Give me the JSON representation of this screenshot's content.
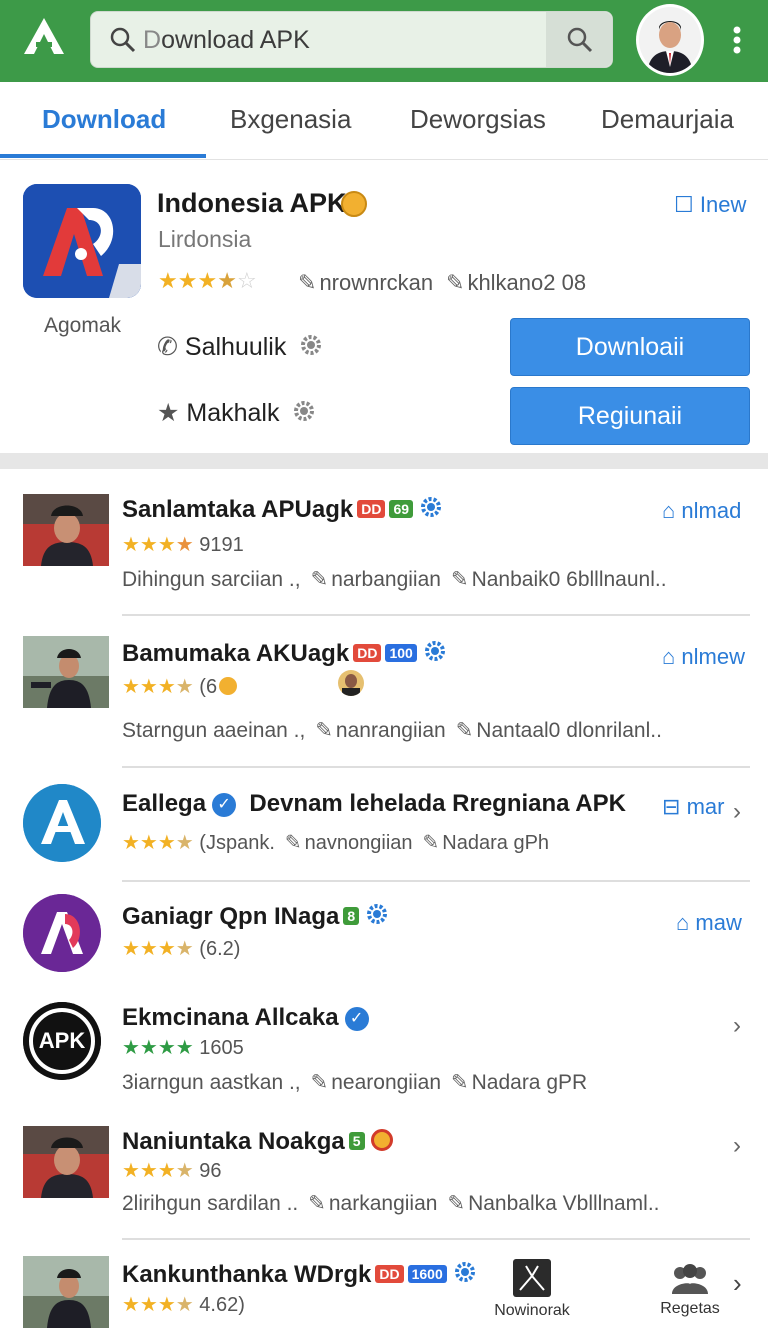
{
  "search": {
    "value": "ownload APK",
    "prefix": "D"
  },
  "tabs": [
    "Download",
    "Bxgenasia",
    "Deworgsias",
    "Demaurjaia"
  ],
  "featured": {
    "title": "Indonesia APK",
    "subtitle": "Lirdonsia",
    "developer": "Agomak",
    "new_label": "Inew",
    "rating": "3.5",
    "meta1": "nrownrckan",
    "meta2": "khlkano2 08",
    "action1": "Salhuulik",
    "action2": "Makhalk",
    "button1": "Downloaii",
    "button2": "Regiunaii"
  },
  "items": [
    {
      "name": "Sanlamtaka APUagk",
      "badges": [
        "DD",
        "69"
      ],
      "rating_text": "9191",
      "stars": 4,
      "meta_a": "Dihingun sarciian .,",
      "meta_b": "narbangiian",
      "meta_c": "Nanbaik0 6blllnaunl..",
      "action": "nlmad"
    },
    {
      "name": "Bamumaka AKUagk",
      "badges": [
        "DD",
        "100"
      ],
      "rating_text": "(6",
      "stars": 3.5,
      "meta_a": "Starngun aaeinan .,",
      "meta_b": "nanrangiian",
      "meta_c": "Nantaal0 dlonrilanl..",
      "action": "nlmew"
    },
    {
      "name": "Eallega",
      "name2": "Devnam lehelada  Rregniana APK",
      "rating_text": "(Jspank.",
      "stars": 3.5,
      "meta_b": "navnongiian",
      "meta_c": "Nadara gPh",
      "action": "mar"
    },
    {
      "name": "Ganiagr Qpn INaga",
      "badges": [
        "8"
      ],
      "rating_text": "(6.2)",
      "stars": 3.5,
      "action": "maw"
    },
    {
      "name": "Ekmcinana Allcaka",
      "rating_text": "1605",
      "stars": 4,
      "meta_a": "3iarngun aastkan .,",
      "meta_b": "nearongiian",
      "meta_c": "Nadara gPR"
    },
    {
      "name": "Naniuntaka Noakga",
      "badges": [
        "5"
      ],
      "rating_text": "96",
      "stars": 3.5,
      "meta_a": "2lirihgun sardilan ..",
      "meta_b": "narkangiian",
      "meta_c": "Nanbalka Vblllnaml.."
    },
    {
      "name": "Kankunthanka WDrgk",
      "badges": [
        "DD",
        "1600"
      ],
      "rating_text": "4.62)",
      "stars": 3.5
    }
  ],
  "bottom_nav": {
    "a": "Nowinorak",
    "b": "Regetas"
  },
  "colors": {
    "header": "#3d9a48",
    "accent": "#2a7bd6",
    "button": "#3a8ee6"
  }
}
